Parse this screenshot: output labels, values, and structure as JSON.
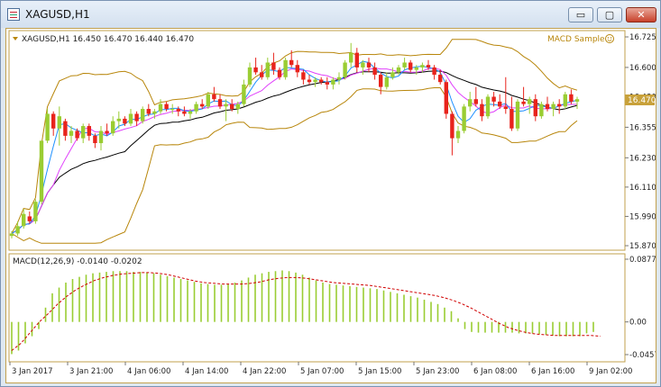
{
  "window": {
    "title": "XAGUSD,H1",
    "minimize_glyph": "▭",
    "restore_glyph": "▢",
    "close_glyph": "✕"
  },
  "chart": {
    "header": "XAGUSD,H1  16.450 16.470 16.440 16.470",
    "expert_label": "MACD Sample",
    "expert_icon": "smiley-icon",
    "price_label": "16.470",
    "price_ticks": [
      "16.725",
      "16.600",
      "16.480",
      "16.355",
      "16.230",
      "16.110",
      "15.990",
      "15.870"
    ],
    "macd_header": "MACD(12,26,9) -0.0140 -0.0202",
    "macd_ticks": [
      "0.0877",
      "0.00",
      "-0.0457"
    ],
    "time_ticks": [
      "3 Jan 2017",
      "3 Jan 21:00",
      "4 Jan 06:00",
      "4 Jan 14:00",
      "4 Jan 22:00",
      "5 Jan 07:00",
      "5 Jan 15:00",
      "5 Jan 23:00",
      "6 Jan 08:00",
      "6 Jan 16:00",
      "9 Jan 02:00"
    ],
    "colors": {
      "bull": "#9acd32",
      "bear": "#e8231c",
      "frame": "#c2a04d",
      "bands": "#b8860b",
      "ma_fast": "#1e90ff",
      "ma_mid": "#e040fb",
      "ma_slow": "#000000",
      "signal": "#d00000"
    }
  },
  "chart_data": {
    "type": "candlestick",
    "symbol": "XAGUSD",
    "timeframe": "H1",
    "price_ylim": [
      15.87,
      16.725
    ],
    "current_price": 16.47,
    "candles": [
      [
        15.91,
        15.93,
        15.9,
        15.92
      ],
      [
        15.92,
        15.97,
        15.91,
        15.95
      ],
      [
        15.95,
        16.02,
        15.94,
        16.0
      ],
      [
        15.99,
        16.01,
        15.96,
        15.97
      ],
      [
        15.97,
        16.06,
        15.96,
        16.05
      ],
      [
        16.05,
        16.2,
        16.04,
        16.3
      ],
      [
        16.3,
        16.43,
        16.29,
        16.41
      ],
      [
        16.41,
        16.42,
        16.32,
        16.35
      ],
      [
        16.35,
        16.44,
        16.28,
        16.4
      ],
      [
        16.38,
        16.39,
        16.3,
        16.32
      ],
      [
        16.32,
        16.36,
        16.29,
        16.34
      ],
      [
        16.34,
        16.35,
        16.3,
        16.31
      ],
      [
        16.31,
        16.37,
        16.29,
        16.36
      ],
      [
        16.36,
        16.37,
        16.3,
        16.32
      ],
      [
        16.32,
        16.33,
        16.27,
        16.29
      ],
      [
        16.29,
        16.36,
        16.26,
        16.34
      ],
      [
        16.34,
        16.37,
        16.32,
        16.33
      ],
      [
        16.33,
        16.4,
        16.32,
        16.38
      ],
      [
        16.38,
        16.42,
        16.35,
        16.39
      ],
      [
        16.39,
        16.4,
        16.36,
        16.37
      ],
      [
        16.37,
        16.43,
        16.36,
        16.41
      ],
      [
        16.41,
        16.42,
        16.36,
        16.38
      ],
      [
        16.38,
        16.44,
        16.37,
        16.43
      ],
      [
        16.43,
        16.45,
        16.4,
        16.41
      ],
      [
        16.41,
        16.43,
        16.39,
        16.42
      ],
      [
        16.42,
        16.47,
        16.41,
        16.45
      ],
      [
        16.45,
        16.46,
        16.42,
        16.43
      ],
      [
        16.43,
        16.45,
        16.41,
        16.43
      ],
      [
        16.43,
        16.44,
        16.4,
        16.42
      ],
      [
        16.42,
        16.44,
        16.4,
        16.41
      ],
      [
        16.41,
        16.43,
        16.39,
        16.42
      ],
      [
        16.42,
        16.46,
        16.41,
        16.45
      ],
      [
        16.45,
        16.47,
        16.43,
        16.44
      ],
      [
        16.44,
        16.5,
        16.43,
        16.49
      ],
      [
        16.49,
        16.52,
        16.46,
        16.47
      ],
      [
        16.47,
        16.49,
        16.43,
        16.44
      ],
      [
        16.44,
        16.47,
        16.38,
        16.45
      ],
      [
        16.45,
        16.47,
        16.42,
        16.43
      ],
      [
        16.43,
        16.46,
        16.41,
        16.45
      ],
      [
        16.45,
        16.55,
        16.44,
        16.53
      ],
      [
        16.53,
        16.62,
        16.52,
        16.6
      ],
      [
        16.6,
        16.64,
        16.57,
        16.58
      ],
      [
        16.58,
        16.61,
        16.55,
        16.56
      ],
      [
        16.56,
        16.64,
        16.55,
        16.62
      ],
      [
        16.62,
        16.66,
        16.57,
        16.59
      ],
      [
        16.59,
        16.6,
        16.55,
        16.56
      ],
      [
        16.56,
        16.64,
        16.55,
        16.63
      ],
      [
        16.63,
        16.67,
        16.6,
        16.61
      ],
      [
        16.61,
        16.63,
        16.56,
        16.58
      ],
      [
        16.58,
        16.59,
        16.53,
        16.55
      ],
      [
        16.55,
        16.57,
        16.53,
        16.54
      ],
      [
        16.54,
        16.56,
        16.52,
        16.55
      ],
      [
        16.55,
        16.56,
        16.53,
        16.54
      ],
      [
        16.54,
        16.56,
        16.51,
        16.53
      ],
      [
        16.53,
        16.56,
        16.51,
        16.55
      ],
      [
        16.55,
        16.58,
        16.53,
        16.56
      ],
      [
        16.56,
        16.63,
        16.55,
        16.62
      ],
      [
        16.62,
        16.7,
        16.6,
        16.66
      ],
      [
        16.66,
        16.68,
        16.58,
        16.6
      ],
      [
        16.6,
        16.63,
        16.57,
        16.62
      ],
      [
        16.62,
        16.64,
        16.58,
        16.6
      ],
      [
        16.6,
        16.62,
        16.55,
        16.57
      ],
      [
        16.57,
        16.58,
        16.49,
        16.52
      ],
      [
        16.52,
        16.58,
        16.51,
        16.56
      ],
      [
        16.56,
        16.6,
        16.55,
        16.58
      ],
      [
        16.58,
        16.61,
        16.57,
        16.6
      ],
      [
        16.6,
        16.64,
        16.59,
        16.62
      ],
      [
        16.62,
        16.63,
        16.58,
        16.59
      ],
      [
        16.59,
        16.61,
        16.57,
        16.6
      ],
      [
        16.6,
        16.62,
        16.58,
        16.61
      ],
      [
        16.61,
        16.63,
        16.59,
        16.6
      ],
      [
        16.6,
        16.61,
        16.55,
        16.57
      ],
      [
        16.57,
        16.59,
        16.53,
        16.54
      ],
      [
        16.54,
        16.55,
        16.39,
        16.41
      ],
      [
        16.41,
        16.42,
        16.24,
        16.31
      ],
      [
        16.31,
        16.36,
        16.29,
        16.34
      ],
      [
        16.34,
        16.45,
        16.33,
        16.44
      ],
      [
        16.44,
        16.5,
        16.42,
        16.47
      ],
      [
        16.47,
        16.52,
        16.44,
        16.45
      ],
      [
        16.45,
        16.47,
        16.38,
        16.4
      ],
      [
        16.4,
        16.49,
        16.39,
        16.48
      ],
      [
        16.48,
        16.5,
        16.44,
        16.46
      ],
      [
        16.46,
        16.49,
        16.43,
        16.44
      ],
      [
        16.44,
        16.56,
        16.41,
        16.43
      ],
      [
        16.43,
        16.48,
        16.34,
        16.35
      ],
      [
        16.35,
        16.47,
        16.34,
        16.46
      ],
      [
        16.46,
        16.52,
        16.44,
        16.45
      ],
      [
        16.45,
        16.48,
        16.41,
        16.47
      ],
      [
        16.47,
        16.49,
        16.38,
        16.4
      ],
      [
        16.4,
        16.46,
        16.39,
        16.45
      ],
      [
        16.45,
        16.48,
        16.42,
        16.43
      ],
      [
        16.43,
        16.46,
        16.4,
        16.45
      ],
      [
        16.45,
        16.47,
        16.41,
        16.44
      ],
      [
        16.44,
        16.5,
        16.43,
        16.49
      ],
      [
        16.49,
        16.51,
        16.45,
        16.46
      ],
      [
        16.46,
        16.48,
        16.43,
        16.47
      ]
    ],
    "macd_ylim": [
      -0.0457,
      0.0877
    ],
    "macd_histogram": [
      -0.045,
      -0.04,
      -0.03,
      -0.02,
      -0.01,
      0.02,
      0.04,
      0.048,
      0.055,
      0.06,
      0.063,
      0.066,
      0.068,
      0.069,
      0.07,
      0.071,
      0.071,
      0.071,
      0.07,
      0.07,
      0.069,
      0.068,
      0.066,
      0.064,
      0.062,
      0.06,
      0.058,
      0.056,
      0.054,
      0.053,
      0.052,
      0.052,
      0.053,
      0.055,
      0.058,
      0.062,
      0.066,
      0.068,
      0.07,
      0.071,
      0.072,
      0.071,
      0.069,
      0.066,
      0.062,
      0.058,
      0.055,
      0.053,
      0.052,
      0.051,
      0.05,
      0.049,
      0.048,
      0.047,
      0.046,
      0.044,
      0.042,
      0.04,
      0.038,
      0.036,
      0.034,
      0.031,
      0.028,
      0.025,
      0.02,
      0.015,
      0.005,
      -0.01,
      -0.014,
      -0.015,
      -0.015,
      -0.015,
      -0.015,
      -0.015,
      -0.015,
      -0.016,
      -0.016,
      -0.016,
      -0.017,
      -0.018,
      -0.019,
      -0.02,
      -0.02,
      -0.02,
      -0.02,
      -0.016,
      -0.014
    ],
    "macd_signal": [
      -0.04,
      -0.03,
      -0.015,
      0.0,
      0.012,
      0.025,
      0.036,
      0.045,
      0.052,
      0.058,
      0.062,
      0.065,
      0.067,
      0.068,
      0.069,
      0.069,
      0.068,
      0.066,
      0.063,
      0.06,
      0.057,
      0.055,
      0.054,
      0.053,
      0.053,
      0.053,
      0.054,
      0.056,
      0.059,
      0.061,
      0.062,
      0.062,
      0.061,
      0.059,
      0.057,
      0.055,
      0.054,
      0.053,
      0.052,
      0.051,
      0.049,
      0.047,
      0.045,
      0.043,
      0.041,
      0.039,
      0.037,
      0.034,
      0.03,
      0.025,
      0.019,
      0.012,
      0.005,
      -0.002,
      -0.008,
      -0.012,
      -0.015,
      -0.017,
      -0.018,
      -0.019,
      -0.019,
      -0.019,
      -0.019,
      -0.019,
      -0.02
    ]
  }
}
